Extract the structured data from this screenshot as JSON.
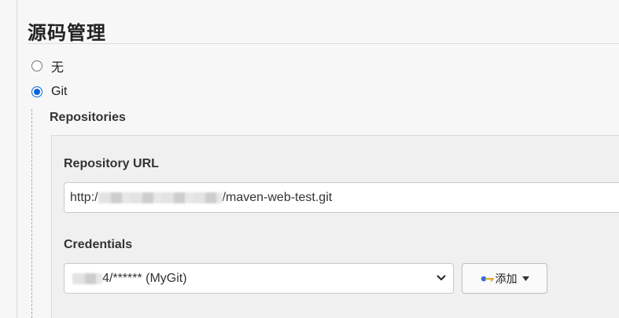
{
  "section": {
    "title": "源码管理"
  },
  "scm": {
    "options": [
      {
        "label": "无",
        "selected": false
      },
      {
        "label": "Git",
        "selected": true
      }
    ]
  },
  "git": {
    "repositories_label": "Repositories",
    "repository_url_label": "Repository URL",
    "repository_url_prefix": "http:/",
    "repository_url_suffix": "/maven-web-test.git",
    "credentials_label": "Credentials",
    "credentials_value_suffix": "4/****** (MyGit)",
    "add_button_label": "添加"
  },
  "icons": {
    "add_button_icon": "key-icon",
    "select_indicator": "chevron-down-icon",
    "dropdown_indicator": "caret-down-icon"
  },
  "colors": {
    "radio_selected": "#0b63d6",
    "key_icon": "#3a6fd0"
  }
}
